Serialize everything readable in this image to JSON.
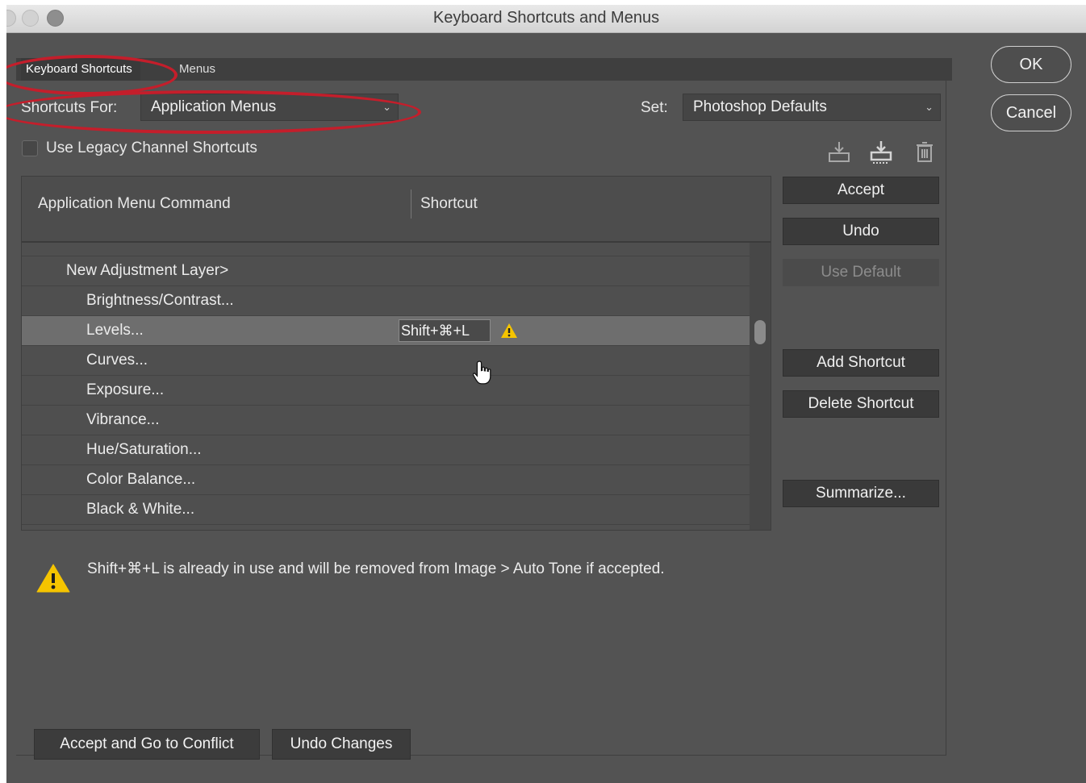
{
  "window": {
    "title": "Keyboard Shortcuts and Menus"
  },
  "tabs": [
    {
      "label": "Keyboard Shortcuts",
      "active": true
    },
    {
      "label": "Menus",
      "active": false
    }
  ],
  "shortcuts_for": {
    "label": "Shortcuts For:",
    "value": "Application Menus"
  },
  "set": {
    "label": "Set:",
    "value": "Photoshop Defaults"
  },
  "legacy_checkbox": {
    "label": "Use Legacy Channel Shortcuts",
    "checked": false
  },
  "set_icons": [
    "save-set-icon",
    "save-set-as-icon",
    "delete-set-icon"
  ],
  "table": {
    "columns": [
      "Application Menu Command",
      "Shortcut"
    ],
    "rows": [
      {
        "label": "New Adjustment Layer>",
        "level": 1,
        "shortcut": "",
        "selected": false
      },
      {
        "label": "Brightness/Contrast...",
        "level": 2,
        "shortcut": "",
        "selected": false
      },
      {
        "label": "Levels...",
        "level": 2,
        "shortcut": "Shift+⌘+L",
        "selected": true,
        "warning": true
      },
      {
        "label": "Curves...",
        "level": 2,
        "shortcut": "",
        "selected": false
      },
      {
        "label": "Exposure...",
        "level": 2,
        "shortcut": "",
        "selected": false
      },
      {
        "label": "Vibrance...",
        "level": 2,
        "shortcut": "",
        "selected": false
      },
      {
        "label": "Hue/Saturation...",
        "level": 2,
        "shortcut": "",
        "selected": false
      },
      {
        "label": "Color Balance...",
        "level": 2,
        "shortcut": "",
        "selected": false
      },
      {
        "label": "Black & White...",
        "level": 2,
        "shortcut": "",
        "selected": false
      }
    ]
  },
  "side_buttons": {
    "accept": "Accept",
    "undo": "Undo",
    "use_default": "Use Default",
    "add_shortcut": "Add Shortcut",
    "delete_shortcut": "Delete Shortcut",
    "summarize": "Summarize..."
  },
  "dialog_buttons": {
    "ok": "OK",
    "cancel": "Cancel"
  },
  "warning": {
    "message": "Shift+⌘+L is already in use and will be removed from Image > Auto Tone if accepted."
  },
  "bottom_buttons": {
    "accept_go_conflict": "Accept and Go to Conflict",
    "undo_changes": "Undo Changes"
  },
  "colors": {
    "panel": "#535353",
    "annotation": "#c41e2b",
    "warning_yellow": "#f5c400"
  }
}
